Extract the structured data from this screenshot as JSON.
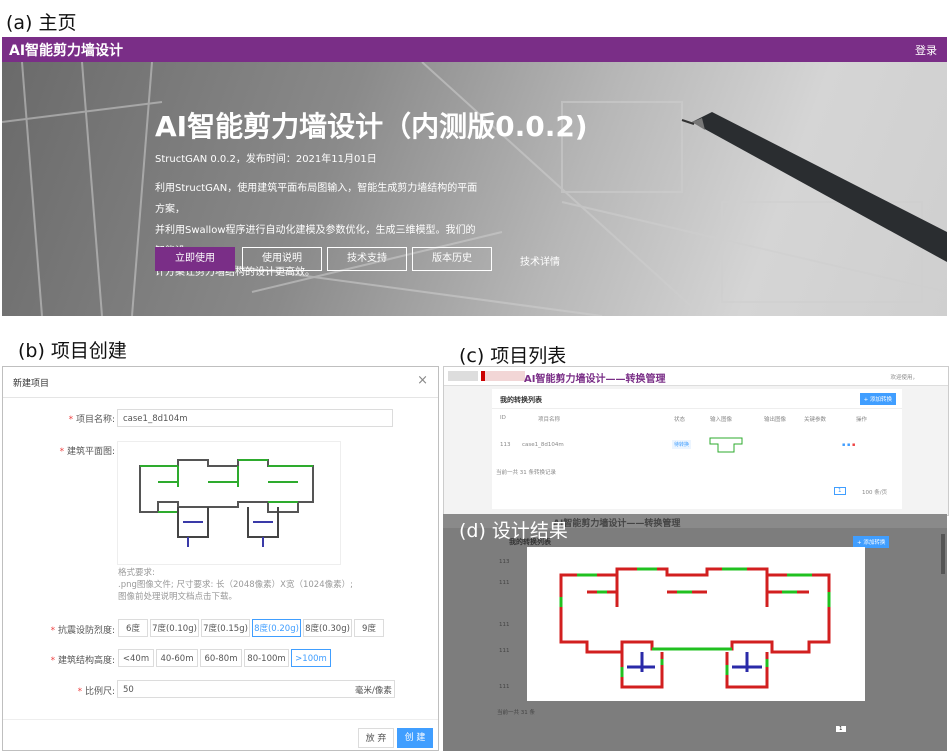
{
  "captions": {
    "a": "(a) 主页",
    "b": "(b) 项目创建",
    "c": "(c) 项目列表",
    "d": "(d) 设计结果"
  },
  "home": {
    "brand": "AI智能剪力墙设计",
    "login": "登录",
    "title": "AI智能剪力墙设计（内测版0.0.2)",
    "subtitle": "StructGAN 0.0.2，发布时间：2021年11月01日",
    "desc": [
      "利用StructGAN，使用建筑平面布局图输入，智能生成剪力墙结构的平面方案，",
      "并利用Swallow程序进行自动化建模及参数优化，生成三维模型。我们的智能设",
      "计方案让剪力墙结构的设计更高效。"
    ],
    "buttons": [
      "立即使用",
      "使用说明",
      "技术支持",
      "版本历史"
    ],
    "link": "技术详情",
    "accent": "#7a2e87"
  },
  "create": {
    "title": "新建项目",
    "close": "×",
    "name_label": "项目名称:",
    "name_value": "case1_8d104m",
    "plan_label": "建筑平面图:",
    "hint": [
      "格式要求:",
      ".png图像文件; 尺寸要求: 长（2048像素）X宽（1024像素）;",
      "图像前处理说明文档点击下载。"
    ],
    "seismic_label": "抗震设防烈度:",
    "seismic_options": [
      "6度",
      "7度(0.10g)",
      "7度(0.15g)",
      "8度(0.20g)",
      "8度(0.30g)",
      "9度"
    ],
    "seismic_selected": "8度(0.20g)",
    "height_label": "建筑结构高度:",
    "height_options": [
      "<40m",
      "40-60m",
      "60-80m",
      "80-100m",
      ">100m"
    ],
    "height_selected": ">100m",
    "scale_label": "比例尺:",
    "scale_value": "50",
    "scale_unit": "毫米/像素",
    "cancel": "放 弃",
    "create": "创 建"
  },
  "list": {
    "header_title": "AI智能剪力墙设计——转换管理",
    "header_right": "欢迎使用，",
    "card_title": "我的转换列表",
    "new_button": "+ 添加转换",
    "columns": [
      "ID",
      "项目名称",
      "状态",
      "输入图像",
      "输出图像",
      "关键参数",
      "操作"
    ],
    "row": {
      "id": "113",
      "name": "case1_8d104m",
      "status": "待转换"
    },
    "footer": "当前一共 31 条转换记录",
    "page": "1",
    "page_size": "100 条/页"
  },
  "result": {
    "header_title": "AI智能剪力墙设计——转换管理",
    "card_title": "我的转换列表",
    "new_button": "+ 添加转换",
    "rows": [
      "113",
      "111",
      "111",
      "111",
      "111"
    ],
    "footer": "当前一共 31 条"
  }
}
